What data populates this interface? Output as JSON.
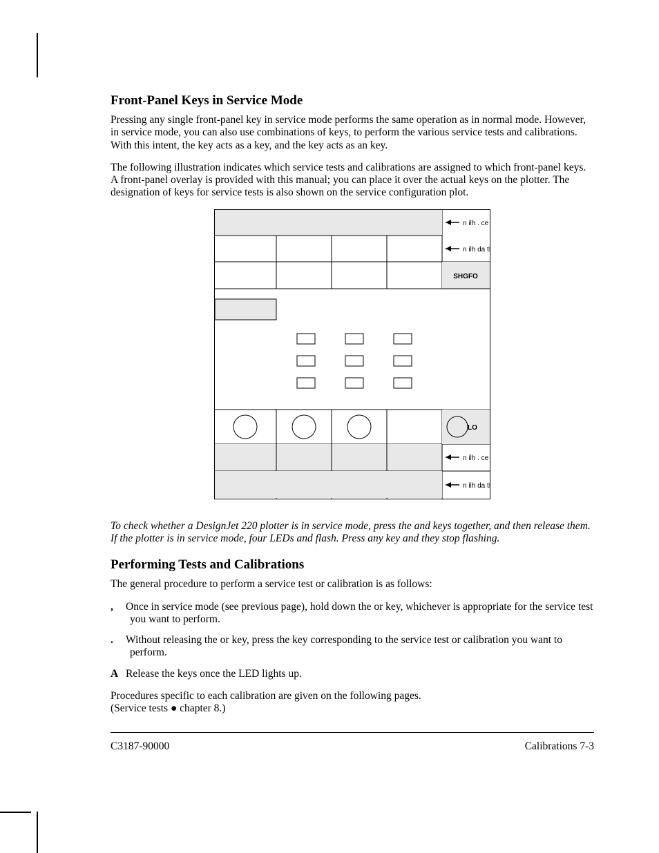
{
  "section1": {
    "heading": "Front-Panel Keys in Service Mode",
    "para1": "Pressing any single front-panel key in service mode performs the same operation as in normal mode.  However, in service mode, you can also use combinations of keys, to perform the various service tests and calibrations.  With this intent, the           key acts as a           key, and the             key acts as an            key.",
    "para2": "The following illustration indicates which service tests and calibrations are assigned to which front-panel keys.  A front-panel overlay is provided with this manual; you can place it over the actual keys on the plotter.  The designation of keys for service tests is also shown on the service configuration plot."
  },
  "figure": {
    "label_top1": "n ilh . ce",
    "label_top2": "n ilh da tNe",
    "label_key_top": "SHGFO",
    "label_key_circle": "LO",
    "label_bot1": "n ilh . ce",
    "label_bot2": "n ilh da tNe"
  },
  "note_italic": "To check whether a DesignJet 220 plotter is in service mode, press the          and              keys together, and then release them.  If the plotter is in service mode, four LEDs                                   and                           flash.  Press any key and they stop flashing.",
  "section2": {
    "heading": "Performing Tests and Calibrations",
    "intro": "The general procedure to perform a service test or calibration is as follows:",
    "steps": [
      {
        "marker": ",",
        "text": "Once in service mode (see previous page), hold down the             or          key, whichever is appropriate for the service test you want to perform."
      },
      {
        "marker": ".",
        "text": "Without releasing the             or          key, press the key corresponding to the service test or calibration you want to perform."
      },
      {
        "marker": "A",
        "text": "Release the keys once the            LED lights up."
      }
    ],
    "outro": "Procedures specific to each calibration are given on the following pages.\n(Service tests ● chapter 8.)"
  },
  "footer": {
    "left": "C3187-90000",
    "right": "Calibrations   7-3"
  }
}
